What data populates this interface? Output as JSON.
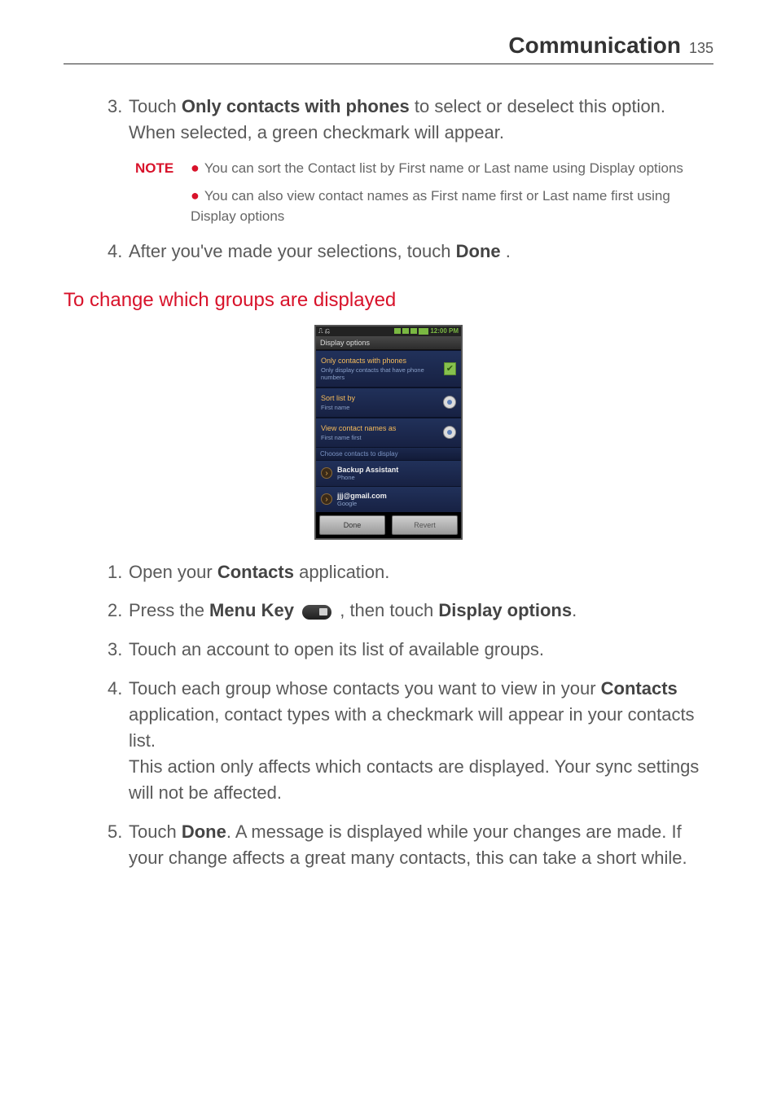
{
  "header": {
    "title": "Communication",
    "page_number": "135"
  },
  "section_a": {
    "step3_num": "3.",
    "step3_pre": "Touch ",
    "step3_bold": "Only contacts with phones",
    "step3_post": " to select or deselect this option. When selected, a green checkmark will appear.",
    "note_label": "NOTE",
    "note1": "You can sort the Contact list by First name or Last name using Display options",
    "note2": "You can also view contact names as First name first or Last name first using Display options",
    "step4_num": "4.",
    "step4_pre": "After you've made your selections, touch ",
    "step4_bold": "Done",
    "step4_post": " ."
  },
  "sub_heading": "To change which groups are displayed",
  "phone": {
    "time": "12:00 PM",
    "titlebar": "Display options",
    "opt1_main": "Only contacts with phones",
    "opt1_sub": "Only display contacts that have phone numbers",
    "opt2_main": "Sort list by",
    "opt2_sub": "First name",
    "opt3_main": "View contact names as",
    "opt3_sub": "First name first",
    "section_label": "Choose contacts to display",
    "acct1_main": "Backup Assistant",
    "acct1_sub": "Phone",
    "acct2_main": "jjj@gmail.com",
    "acct2_sub": "Google",
    "btn_done": "Done",
    "btn_revert": "Revert"
  },
  "section_b": {
    "step1_num": "1.",
    "step1_pre": "Open your ",
    "step1_bold": "Contacts",
    "step1_post": " application.",
    "step2_num": "2.",
    "step2_pre": "Press the ",
    "step2_bold1": "Menu Key",
    "step2_mid": " , then touch ",
    "step2_bold2": "Display options",
    "step2_post": ".",
    "step3_num": "3.",
    "step3_text": "Touch an account to open its list of available groups.",
    "step4_num": "4.",
    "step4_pre": "Touch each group whose contacts you want to view in your ",
    "step4_bold": "Contacts",
    "step4_post": " application, contact types with a checkmark will appear in your contacts list.",
    "step4_line2": "This action only affects which contacts are displayed. Your sync settings will not be affected.",
    "step5_num": "5.",
    "step5_pre": "Touch ",
    "step5_bold": "Done",
    "step5_post": ". A message is displayed while your changes are made. If your change affects a great many contacts, this can take a short while."
  }
}
